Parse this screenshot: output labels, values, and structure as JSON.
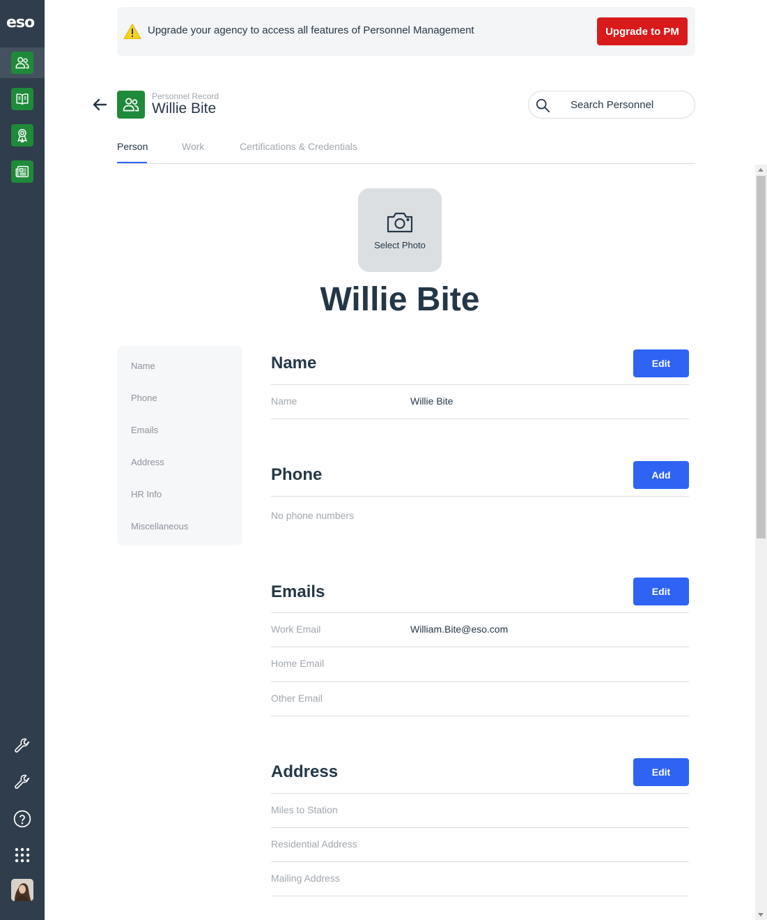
{
  "rail": {
    "logo": "eso",
    "apps": [
      {
        "icon": "people-icon"
      },
      {
        "icon": "book-icon"
      },
      {
        "icon": "award-icon"
      },
      {
        "icon": "newspaper-icon"
      }
    ],
    "tools": [
      {
        "icon": "wrench-icon"
      },
      {
        "icon": "wrench-icon"
      },
      {
        "icon": "help-circle-icon"
      },
      {
        "icon": "app-grid-icon"
      }
    ]
  },
  "banner": {
    "message": "Upgrade your agency to access all features of Personnel Management",
    "button": "Upgrade to PM",
    "icon": "warning-icon"
  },
  "header": {
    "record_label": "Personnel Record",
    "record_name": "Willie Bite",
    "search_placeholder": "Search Personnel"
  },
  "tabs": [
    {
      "label": "Person",
      "active": true
    },
    {
      "label": "Work",
      "active": false
    },
    {
      "label": "Certifications & Credentials",
      "active": false
    }
  ],
  "profile": {
    "photo_label": "Select Photo",
    "display_name": "Willie Bite"
  },
  "section_nav": [
    "Name",
    "Phone",
    "Emails",
    "Address",
    "HR Info",
    "Miscellaneous"
  ],
  "sections": {
    "name": {
      "title": "Name",
      "button": "Edit",
      "fields": [
        {
          "label": "Name",
          "value": "Willie Bite"
        }
      ]
    },
    "phone": {
      "title": "Phone",
      "button": "Add",
      "empty_text": "No phone numbers"
    },
    "emails": {
      "title": "Emails",
      "button": "Edit",
      "fields": [
        {
          "label": "Work Email",
          "value": "William.Bite@eso.com"
        },
        {
          "label": "Home Email",
          "value": ""
        },
        {
          "label": "Other Email",
          "value": ""
        }
      ]
    },
    "address": {
      "title": "Address",
      "button": "Edit",
      "fields": [
        {
          "label": "Miles to Station",
          "value": ""
        },
        {
          "label": "Residential Address",
          "value": ""
        },
        {
          "label": "Mailing Address",
          "value": ""
        }
      ]
    }
  },
  "colors": {
    "rail_bg": "#2f3d4c",
    "app_green": "#1f8a3a",
    "upgrade_red": "#d91a1a",
    "primary_blue": "#2f63f4",
    "text_dark": "#253746",
    "text_muted": "#a0a7ae"
  }
}
